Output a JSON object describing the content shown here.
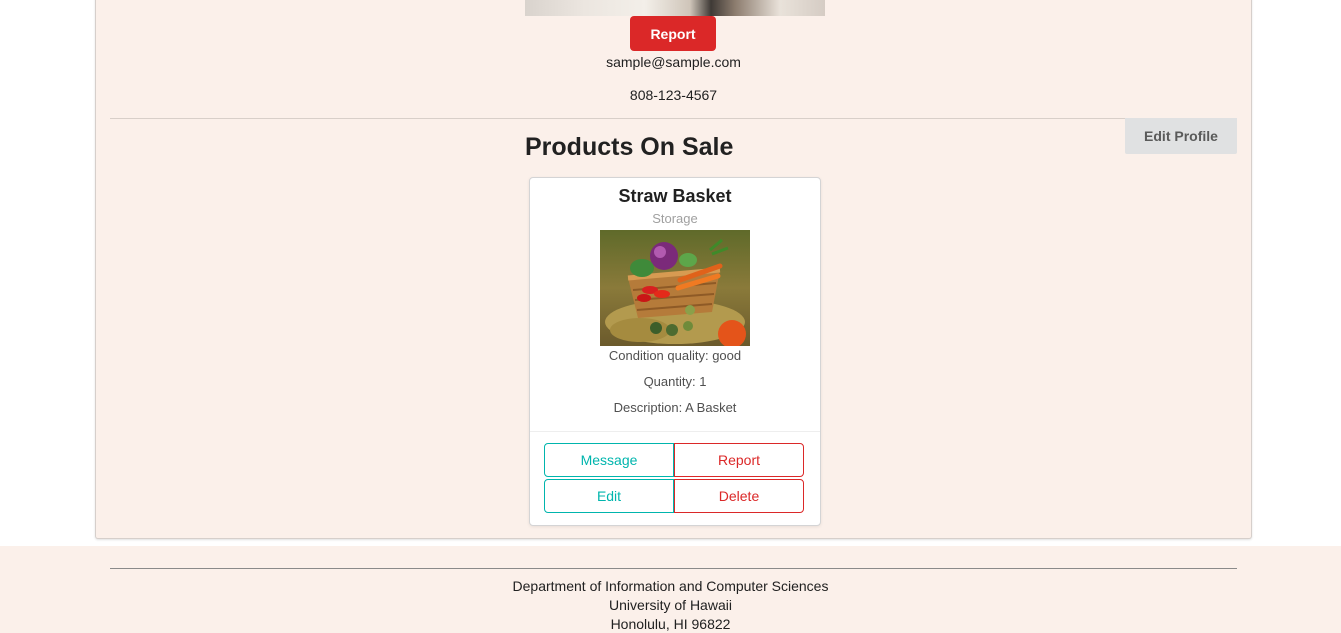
{
  "profile": {
    "report_label": "Report",
    "email": "sample@sample.com",
    "phone": "808-123-4567",
    "edit_profile_label": "Edit Profile"
  },
  "products_section": {
    "title": "Products On Sale"
  },
  "products": [
    {
      "name": "Straw Basket",
      "category": "Storage",
      "condition": "Condition quality: good",
      "quantity": "Quantity: 1",
      "description": "Description: A Basket",
      "buttons": {
        "message": "Message",
        "report": "Report",
        "edit": "Edit",
        "delete": "Delete"
      }
    }
  ],
  "footer": {
    "line1": "Department of Information and Computer Sciences",
    "line2": "University of Hawaii",
    "line3": "Honolulu, HI 96822"
  },
  "colors": {
    "background": "#fbf0ea",
    "danger": "#db2828",
    "teal": "#00b5ad",
    "secondary_button": "#e0e1e2"
  }
}
